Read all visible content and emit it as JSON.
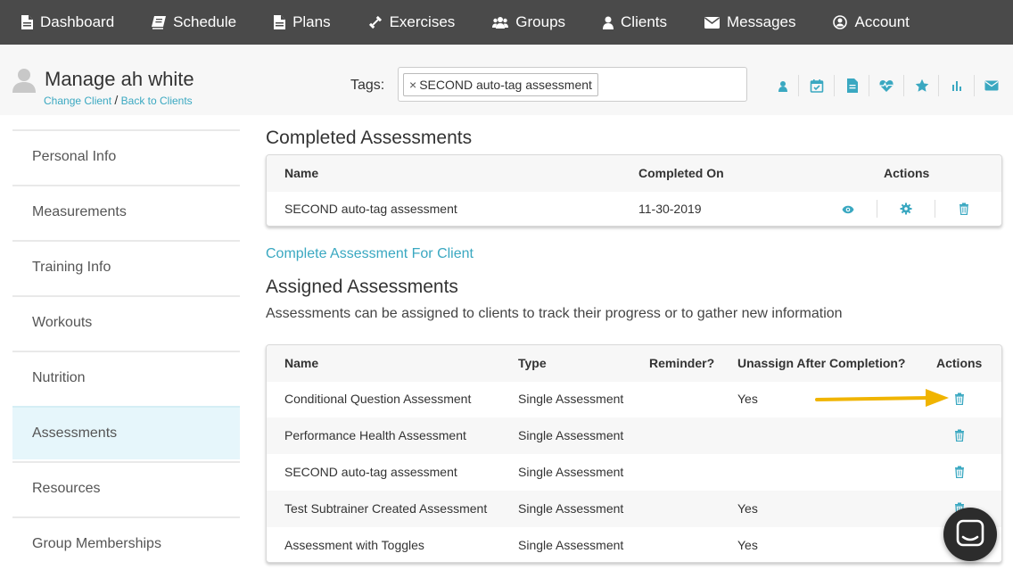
{
  "nav": {
    "items": [
      {
        "label": "Dashboard",
        "icon": "document-icon"
      },
      {
        "label": "Schedule",
        "icon": "book-icon"
      },
      {
        "label": "Plans",
        "icon": "document-icon"
      },
      {
        "label": "Exercises",
        "icon": "dumbbell-icon"
      },
      {
        "label": "Groups",
        "icon": "users-icon"
      },
      {
        "label": "Clients",
        "icon": "user-icon"
      },
      {
        "label": "Messages",
        "icon": "envelope-icon"
      },
      {
        "label": "Account",
        "icon": "account-circle-icon"
      }
    ]
  },
  "header": {
    "title": "Manage ah white",
    "change_client": "Change Client",
    "separator": "/",
    "back_to_clients": "Back to Clients",
    "tags_label": "Tags:",
    "tag_remove": "×",
    "tag": "SECOND auto-tag assessment",
    "accent_color": "#3aa8c1"
  },
  "sidebar": {
    "items": [
      {
        "label": "Personal Info"
      },
      {
        "label": "Measurements"
      },
      {
        "label": "Training Info"
      },
      {
        "label": "Workouts"
      },
      {
        "label": "Nutrition"
      },
      {
        "label": "Assessments",
        "active": true
      },
      {
        "label": "Resources"
      },
      {
        "label": "Group Memberships"
      }
    ]
  },
  "completed": {
    "title": "Completed Assessments",
    "columns": {
      "name": "Name",
      "completed_on": "Completed On",
      "actions": "Actions"
    },
    "rows": [
      {
        "name": "SECOND auto-tag assessment",
        "completed_on": "11-30-2019"
      }
    ],
    "complete_link": "Complete Assessment For Client"
  },
  "assigned": {
    "title": "Assigned Assessments",
    "description": "Assessments can be assigned to clients to track their progress or to gather new information",
    "columns": {
      "name": "Name",
      "type": "Type",
      "reminder": "Reminder?",
      "unassign": "Unassign After Completion?",
      "actions": "Actions"
    },
    "rows": [
      {
        "name": "Conditional Question Assessment",
        "type": "Single Assessment",
        "reminder": "",
        "unassign": "Yes"
      },
      {
        "name": "Performance Health Assessment",
        "type": "Single Assessment",
        "reminder": "",
        "unassign": ""
      },
      {
        "name": "SECOND auto-tag assessment",
        "type": "Single Assessment",
        "reminder": "",
        "unassign": ""
      },
      {
        "name": "Test Subtrainer Created Assessment",
        "type": "Single Assessment",
        "reminder": "",
        "unassign": "Yes"
      },
      {
        "name": "Assessment with Toggles",
        "type": "Single Assessment",
        "reminder": "",
        "unassign": "Yes"
      }
    ]
  },
  "annotation_arrow_color": "#f0b400"
}
